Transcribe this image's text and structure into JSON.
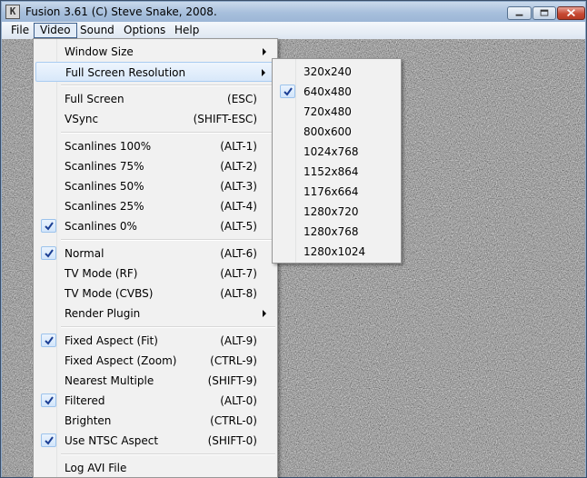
{
  "window": {
    "title": "Fusion 3.61 (C) Steve Snake, 2008.",
    "icon_letter": "K"
  },
  "menubar": [
    "File",
    "Video",
    "Sound",
    "Options",
    "Help"
  ],
  "video_menu": {
    "items": [
      {
        "label": "Window Size",
        "shortcut": "",
        "submenu": true,
        "checked": false
      },
      {
        "label": "Full Screen Resolution",
        "shortcut": "",
        "submenu": true,
        "checked": false,
        "highlighted": true
      },
      {
        "label": "Full Screen",
        "shortcut": "(ESC)",
        "submenu": false,
        "checked": false
      },
      {
        "label": "VSync",
        "shortcut": "(SHIFT-ESC)",
        "submenu": false,
        "checked": false
      },
      {
        "label": "Scanlines 100%",
        "shortcut": "(ALT-1)",
        "submenu": false,
        "checked": false
      },
      {
        "label": "Scanlines 75%",
        "shortcut": "(ALT-2)",
        "submenu": false,
        "checked": false
      },
      {
        "label": "Scanlines 50%",
        "shortcut": "(ALT-3)",
        "submenu": false,
        "checked": false
      },
      {
        "label": "Scanlines 25%",
        "shortcut": "(ALT-4)",
        "submenu": false,
        "checked": false
      },
      {
        "label": "Scanlines 0%",
        "shortcut": "(ALT-5)",
        "submenu": false,
        "checked": true
      },
      {
        "label": "Normal",
        "shortcut": "(ALT-6)",
        "submenu": false,
        "checked": true
      },
      {
        "label": "TV Mode (RF)",
        "shortcut": "(ALT-7)",
        "submenu": false,
        "checked": false
      },
      {
        "label": "TV Mode (CVBS)",
        "shortcut": "(ALT-8)",
        "submenu": false,
        "checked": false
      },
      {
        "label": "Render Plugin",
        "shortcut": "",
        "submenu": true,
        "checked": false
      },
      {
        "label": "Fixed Aspect (Fit)",
        "shortcut": "(ALT-9)",
        "submenu": false,
        "checked": true
      },
      {
        "label": "Fixed Aspect (Zoom)",
        "shortcut": "(CTRL-9)",
        "submenu": false,
        "checked": false
      },
      {
        "label": "Nearest Multiple",
        "shortcut": "(SHIFT-9)",
        "submenu": false,
        "checked": false
      },
      {
        "label": "Filtered",
        "shortcut": "(ALT-0)",
        "submenu": false,
        "checked": true
      },
      {
        "label": "Brighten",
        "shortcut": "(CTRL-0)",
        "submenu": false,
        "checked": false
      },
      {
        "label": "Use NTSC Aspect",
        "shortcut": "(SHIFT-0)",
        "submenu": false,
        "checked": true
      },
      {
        "label": "Log AVI File",
        "shortcut": "",
        "submenu": false,
        "checked": false
      }
    ]
  },
  "resolution_menu": {
    "items": [
      {
        "label": "320x240",
        "checked": false
      },
      {
        "label": "640x480",
        "checked": true
      },
      {
        "label": "720x480",
        "checked": false
      },
      {
        "label": "800x600",
        "checked": false
      },
      {
        "label": "1024x768",
        "checked": false
      },
      {
        "label": "1152x864",
        "checked": false
      },
      {
        "label": "1176x664",
        "checked": false
      },
      {
        "label": "1280x720",
        "checked": false
      },
      {
        "label": "1280x768",
        "checked": false
      },
      {
        "label": "1280x1024",
        "checked": false
      }
    ]
  },
  "colors": {
    "titlebar": "#a7bfdc",
    "menu_background": "#f1f1f1",
    "highlight_border": "#aaccf1",
    "check_mark": "#1c3f94",
    "noise_base": "#808080"
  }
}
